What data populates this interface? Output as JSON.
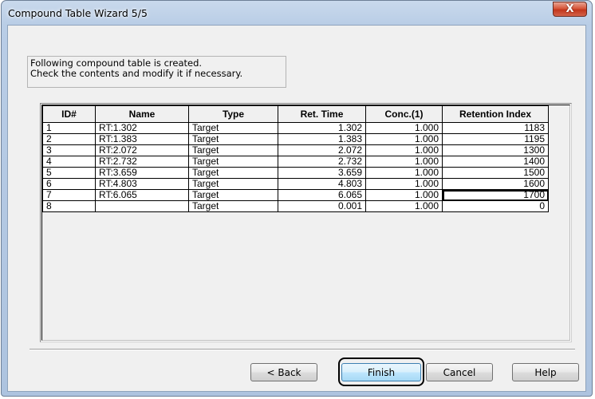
{
  "window": {
    "title": "Compound Table Wizard 5/5",
    "close_label": "X"
  },
  "info": {
    "line1": "Following compound table is created.",
    "line2": "Check the contents and modify it if necessary."
  },
  "table": {
    "columns": [
      "ID#",
      "Name",
      "Type",
      "Ret. Time",
      "Conc.(1)",
      "Retention Index"
    ],
    "rows": [
      {
        "id": "1",
        "name": "RT:1.302",
        "type": "Target",
        "ret_time": "1.302",
        "conc": "1.000",
        "ri": "1183"
      },
      {
        "id": "2",
        "name": "RT:1.383",
        "type": "Target",
        "ret_time": "1.383",
        "conc": "1.000",
        "ri": "1195"
      },
      {
        "id": "3",
        "name": "RT:2.072",
        "type": "Target",
        "ret_time": "2.072",
        "conc": "1.000",
        "ri": "1300"
      },
      {
        "id": "4",
        "name": "RT:2.732",
        "type": "Target",
        "ret_time": "2.732",
        "conc": "1.000",
        "ri": "1400"
      },
      {
        "id": "5",
        "name": "RT:3.659",
        "type": "Target",
        "ret_time": "3.659",
        "conc": "1.000",
        "ri": "1500"
      },
      {
        "id": "6",
        "name": "RT:4.803",
        "type": "Target",
        "ret_time": "4.803",
        "conc": "1.000",
        "ri": "1600"
      },
      {
        "id": "7",
        "name": "RT:6.065",
        "type": "Target",
        "ret_time": "6.065",
        "conc": "1.000",
        "ri": "1700"
      },
      {
        "id": "8",
        "name": "",
        "type": "Target",
        "ret_time": "0.001",
        "conc": "1.000",
        "ri": "0"
      }
    ]
  },
  "buttons": {
    "back": "< Back",
    "finish": "Finish",
    "cancel": "Cancel",
    "help": "Help"
  }
}
